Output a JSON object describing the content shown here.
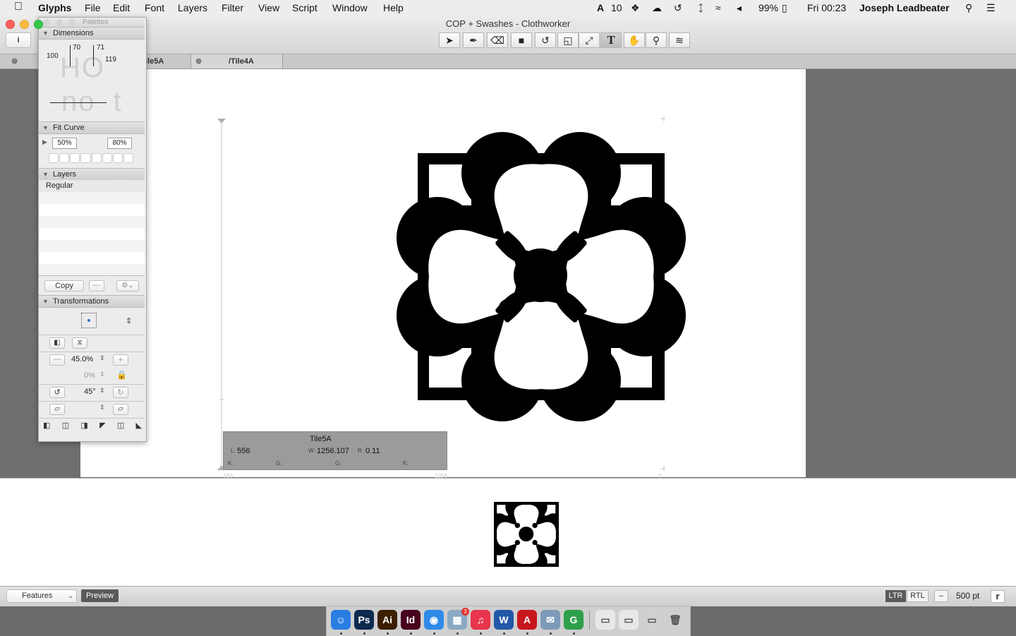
{
  "menubar": {
    "app": "Glyphs",
    "items": [
      "File",
      "Edit",
      "Font",
      "Layers",
      "Filter",
      "View",
      "Script",
      "Window",
      "Help"
    ],
    "status": {
      "adobe_count": "10",
      "battery": "99%",
      "clock": "Fri 00:23",
      "user": "Joseph Leadbeater"
    }
  },
  "window": {
    "title": "COP + Swashes - Clothworker",
    "tabs": [
      "ile5A",
      "/Tile4A"
    ],
    "tools": [
      "select-arrow-icon",
      "pen-icon",
      "eraser-icon",
      "rectangle-icon",
      "rotate-icon",
      "scale-icon",
      "resize-icon",
      "text-tool-icon",
      "hand-icon",
      "zoom-icon",
      "measure-icon"
    ],
    "active_tool_glyph": "T"
  },
  "palette": {
    "title": "Palettes",
    "dimensions": {
      "label": "Dimensions",
      "values": [
        "100",
        "70",
        "71",
        "119"
      ],
      "preview_top": "HO",
      "preview_bottom": "no t"
    },
    "fit_curve": {
      "label": "Fit Curve",
      "min": "50%",
      "max": "80%"
    },
    "layers": {
      "label": "Layers",
      "items": [
        "Regular"
      ],
      "copy_button": "Copy"
    },
    "transformations": {
      "label": "Transformations",
      "scale": "45.0%",
      "scale_secondary": "0%",
      "rotate": "45°"
    }
  },
  "glyph_info": {
    "name": "Tile5A",
    "lsb_label": "L:",
    "lsb": "556",
    "width_label": "W:",
    "width": "1256.107",
    "rsb_label": "R:",
    "rsb": "0.11",
    "kern_left_label": "K:",
    "group_left_label": "G:",
    "group_right_label": "G:",
    "kern_right_label": "K:",
    "ruler_left": "556",
    "ruler_mid": "1256",
    "ruler_right": "0"
  },
  "bottombar": {
    "features": "Features",
    "preview": "Preview",
    "ltr": "LTR",
    "rtl": "RTL",
    "size": "500 pt"
  },
  "dock": {
    "apps": [
      {
        "name": "finder-icon",
        "glyph": "☺",
        "color": "#2a7de1"
      },
      {
        "name": "photoshop-icon",
        "glyph": "Ps",
        "color": "#0d2a4d"
      },
      {
        "name": "illustrator-icon",
        "glyph": "Ai",
        "color": "#3b1f00"
      },
      {
        "name": "indesign-icon",
        "glyph": "Id",
        "color": "#49021f"
      },
      {
        "name": "safari-icon",
        "glyph": "◉",
        "color": "#2f8ae8"
      },
      {
        "name": "preview-icon",
        "glyph": "▦",
        "color": "#8aa9c4"
      },
      {
        "name": "itunes-icon",
        "glyph": "♫",
        "color": "#e8344d"
      },
      {
        "name": "word-icon",
        "glyph": "W",
        "color": "#2158a8"
      },
      {
        "name": "acrobat-icon",
        "glyph": "A",
        "color": "#c8161d"
      },
      {
        "name": "mail-icon",
        "glyph": "✉",
        "color": "#7d9bb8"
      },
      {
        "name": "glyphs-icon",
        "glyph": "G",
        "color": "#2ea04b"
      },
      {
        "name": "window1-icon",
        "glyph": "▭",
        "color": "#e8e8e8"
      },
      {
        "name": "window2-icon",
        "glyph": "▭",
        "color": "#e8e8e8"
      },
      {
        "name": "window3-icon",
        "glyph": "▭",
        "color": "#d0d0d0"
      },
      {
        "name": "trash-icon",
        "glyph": "🗑",
        "color": "#cfcfcf"
      }
    ],
    "notification_badge": "3"
  }
}
